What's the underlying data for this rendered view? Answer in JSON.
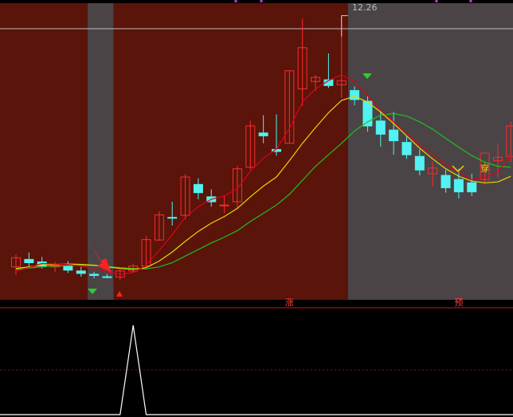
{
  "chart_data": [
    {
      "type": "candlestick",
      "name": "main-panel",
      "price_label": "12.26",
      "ylim": [
        5.4,
        12.6
      ],
      "colors": {
        "up_candle": "#ff2a2a",
        "down_candle": "#52f2f2",
        "ma_short": "#e0001a",
        "ma_mid": "#e8d800",
        "ma_long": "#1fbf1f",
        "zone_red": "#5a140a",
        "zone_gray": "#4a4446"
      },
      "candles": [
        {
          "o": 6.2,
          "h": 6.5,
          "l": 6.0,
          "c": 6.42
        },
        {
          "o": 6.38,
          "h": 6.55,
          "l": 6.2,
          "c": 6.3
        },
        {
          "o": 6.32,
          "h": 6.44,
          "l": 6.16,
          "c": 6.22
        },
        {
          "o": 6.2,
          "h": 6.32,
          "l": 6.08,
          "c": 6.24
        },
        {
          "o": 6.22,
          "h": 6.34,
          "l": 6.05,
          "c": 6.12
        },
        {
          "o": 6.1,
          "h": 6.2,
          "l": 5.96,
          "c": 6.04
        },
        {
          "o": 6.02,
          "h": 6.08,
          "l": 5.92,
          "c": 5.99
        },
        {
          "o": 5.96,
          "h": 6.03,
          "l": 5.92,
          "c": 5.95
        },
        {
          "o": 5.95,
          "h": 6.14,
          "l": 5.88,
          "c": 6.1
        },
        {
          "o": 6.1,
          "h": 6.28,
          "l": 6.06,
          "c": 6.22
        },
        {
          "o": 6.22,
          "h": 6.95,
          "l": 6.2,
          "c": 6.86
        },
        {
          "o": 6.85,
          "h": 7.55,
          "l": 6.83,
          "c": 7.46
        },
        {
          "o": 7.4,
          "h": 7.78,
          "l": 7.2,
          "c": 7.38
        },
        {
          "o": 7.45,
          "h": 8.45,
          "l": 7.35,
          "c": 8.38
        },
        {
          "o": 8.2,
          "h": 8.35,
          "l": 7.84,
          "c": 8.0
        },
        {
          "o": 7.9,
          "h": 8.08,
          "l": 7.66,
          "c": 7.78
        },
        {
          "o": 7.68,
          "h": 7.94,
          "l": 7.5,
          "c": 7.7
        },
        {
          "o": 7.78,
          "h": 8.65,
          "l": 7.6,
          "c": 8.58
        },
        {
          "o": 8.62,
          "h": 9.75,
          "l": 8.56,
          "c": 9.62
        },
        {
          "o": 9.45,
          "h": 9.88,
          "l": 9.2,
          "c": 9.38
        },
        {
          "o": 9.05,
          "h": 9.9,
          "l": 8.9,
          "c": 9.0
        },
        {
          "o": 9.2,
          "h": 10.96,
          "l": 9.2,
          "c": 10.96
        },
        {
          "o": 10.52,
          "h": 12.22,
          "l": 10.1,
          "c": 11.52
        },
        {
          "o": 10.7,
          "h": 10.86,
          "l": 10.48,
          "c": 10.8
        },
        {
          "o": 10.74,
          "h": 11.38,
          "l": 10.54,
          "c": 10.6
        },
        {
          "o": 10.62,
          "h": 12.26,
          "l": 10.3,
          "c": 10.72
        },
        {
          "o": 10.48,
          "h": 10.58,
          "l": 10.12,
          "c": 10.26
        },
        {
          "o": 10.22,
          "h": 10.34,
          "l": 9.48,
          "c": 9.62
        },
        {
          "o": 9.74,
          "h": 9.98,
          "l": 9.12,
          "c": 9.42
        },
        {
          "o": 9.52,
          "h": 9.96,
          "l": 8.92,
          "c": 9.26
        },
        {
          "o": 9.22,
          "h": 9.36,
          "l": 8.82,
          "c": 8.92
        },
        {
          "o": 8.88,
          "h": 9.05,
          "l": 8.42,
          "c": 8.55
        },
        {
          "o": 8.46,
          "h": 8.76,
          "l": 8.14,
          "c": 8.6
        },
        {
          "o": 8.42,
          "h": 8.55,
          "l": 8.0,
          "c": 8.12
        },
        {
          "o": 8.32,
          "h": 8.58,
          "l": 7.86,
          "c": 8.02
        },
        {
          "o": 8.24,
          "h": 8.46,
          "l": 7.92,
          "c": 8.02
        },
        {
          "o": 8.32,
          "h": 8.76,
          "l": 8.2,
          "c": 8.96
        },
        {
          "o": 8.78,
          "h": 9.2,
          "l": 8.36,
          "c": 8.86
        },
        {
          "o": 8.88,
          "h": 9.72,
          "l": 8.74,
          "c": 9.62
        }
      ],
      "ma_short": [
        6.1,
        6.18,
        6.28,
        6.27,
        6.26,
        6.22,
        6.16,
        6.08,
        6.02,
        6.06,
        6.24,
        6.6,
        6.98,
        7.4,
        7.66,
        7.84,
        7.92,
        8.1,
        8.52,
        8.84,
        9.06,
        9.56,
        10.2,
        10.52,
        10.72,
        10.86,
        10.7,
        10.36,
        10.0,
        9.72,
        9.44,
        9.14,
        8.92,
        8.68,
        8.5,
        8.32,
        8.36,
        8.52,
        8.88
      ],
      "ma_mid": [
        6.16,
        6.2,
        6.24,
        6.26,
        6.27,
        6.26,
        6.24,
        6.2,
        6.16,
        6.14,
        6.18,
        6.34,
        6.56,
        6.82,
        7.06,
        7.26,
        7.42,
        7.62,
        7.9,
        8.16,
        8.38,
        8.78,
        9.2,
        9.58,
        9.94,
        10.24,
        10.34,
        10.2,
        9.96,
        9.68,
        9.38,
        9.08,
        8.82,
        8.58,
        8.4,
        8.28,
        8.24,
        8.26,
        8.4
      ],
      "ma_long": [
        6.14,
        6.17,
        6.2,
        6.22,
        6.23,
        6.24,
        6.23,
        6.21,
        6.18,
        6.16,
        6.15,
        6.2,
        6.3,
        6.46,
        6.62,
        6.78,
        6.92,
        7.08,
        7.3,
        7.5,
        7.7,
        7.96,
        8.3,
        8.64,
        8.92,
        9.2,
        9.5,
        9.72,
        9.88,
        9.92,
        9.86,
        9.72,
        9.54,
        9.32,
        9.1,
        8.9,
        8.74,
        8.64,
        8.62
      ],
      "zones": [
        {
          "from": 0,
          "to": 5,
          "kind": "red"
        },
        {
          "from": 6,
          "to": 7,
          "kind": "gray"
        },
        {
          "from": 8,
          "to": 25,
          "kind": "red"
        },
        {
          "from": 26,
          "to": 38,
          "kind": "gray"
        }
      ],
      "reference_value": 12.26,
      "markers": [
        {
          "label": "涨",
          "index": 21
        },
        {
          "label": "预",
          "index": 34
        },
        {
          "label": "穿",
          "index": 36
        }
      ]
    },
    {
      "type": "line",
      "name": "signal-panel",
      "colors": {
        "line": "#ffffff",
        "reference": "#8a1010"
      },
      "values": [
        0,
        0,
        0,
        0,
        0,
        0,
        0,
        0,
        0,
        1,
        0,
        0,
        0,
        0,
        0,
        0,
        0,
        0,
        0,
        0,
        0,
        0,
        0,
        0,
        0,
        0,
        0,
        0,
        0,
        0,
        0,
        0,
        0,
        0,
        0,
        0,
        0,
        0,
        0
      ]
    }
  ]
}
